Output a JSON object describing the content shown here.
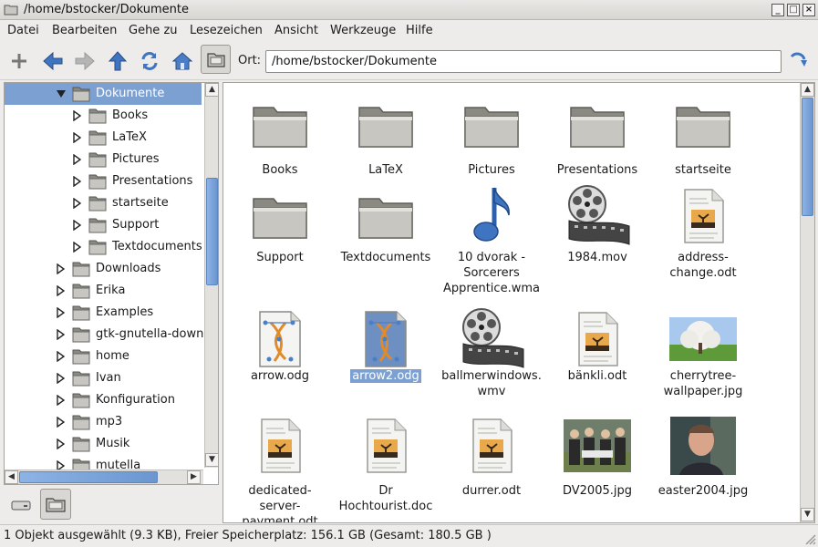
{
  "window": {
    "title": "/home/bstocker/Dokumente"
  },
  "menu": [
    "Datei",
    "Bearbeiten",
    "Gehe zu",
    "Lesezeichen",
    "Ansicht",
    "Werkzeuge",
    "Hilfe"
  ],
  "toolbar": {
    "location_label": "Ort:",
    "location_value": "/home/bstocker/Dokumente",
    "buttons": [
      "new-tab-icon",
      "back-icon",
      "forward-icon",
      "up-icon",
      "reload-icon",
      "home-icon",
      "folder-view-icon",
      "go-icon"
    ]
  },
  "tree": [
    {
      "label": "Dokumente",
      "level": 0,
      "expanded": true,
      "selected": true
    },
    {
      "label": "Books",
      "level": 1
    },
    {
      "label": "LaTeX",
      "level": 1
    },
    {
      "label": "Pictures",
      "level": 1
    },
    {
      "label": "Presentations",
      "level": 1
    },
    {
      "label": "startseite",
      "level": 1
    },
    {
      "label": "Support",
      "level": 1
    },
    {
      "label": "Textdocuments",
      "level": 1
    },
    {
      "label": "Downloads",
      "level": 0
    },
    {
      "label": "Erika",
      "level": 0
    },
    {
      "label": "Examples",
      "level": 0
    },
    {
      "label": "gtk-gnutella-down",
      "level": 0
    },
    {
      "label": "home",
      "level": 0
    },
    {
      "label": "Ivan",
      "level": 0
    },
    {
      "label": "Konfiguration",
      "level": 0
    },
    {
      "label": "mp3",
      "level": 0
    },
    {
      "label": "Musik",
      "level": 0
    },
    {
      "label": "mutella",
      "level": 0
    }
  ],
  "items": [
    {
      "name": "Books",
      "type": "folder"
    },
    {
      "name": "LaTeX",
      "type": "folder"
    },
    {
      "name": "Pictures",
      "type": "folder"
    },
    {
      "name": "Presentations",
      "type": "folder"
    },
    {
      "name": "startseite",
      "type": "folder"
    },
    {
      "name": "Support",
      "type": "folder"
    },
    {
      "name": "Textdocuments",
      "type": "folder"
    },
    {
      "name": "10 dvorak -\nSorcerers\nApprentice.wma",
      "type": "audio"
    },
    {
      "name": "1984.mov",
      "type": "video"
    },
    {
      "name": "address-\nchange.odt",
      "type": "odt"
    },
    {
      "name": "arrow.odg",
      "type": "odg"
    },
    {
      "name": "arrow2.odg",
      "type": "odg",
      "selected": true
    },
    {
      "name": "ballmerwindows.\nwmv",
      "type": "video"
    },
    {
      "name": "bänkli.odt",
      "type": "odt"
    },
    {
      "name": "cherrytree-\nwallpaper.jpg",
      "type": "photo-tree"
    },
    {
      "name": "dedicated-\nserver-\npayment.odt",
      "type": "odt"
    },
    {
      "name": "Dr\nHochtourist.doc",
      "type": "odt"
    },
    {
      "name": "durrer.odt",
      "type": "odt"
    },
    {
      "name": "DV2005.jpg",
      "type": "photo-group"
    },
    {
      "name": "easter2004.jpg",
      "type": "photo-person"
    }
  ],
  "status": "1 Objekt ausgewählt (9.3 KB), Freier Speicherplatz: 156.1 GB (Gesamt: 180.5 GB )"
}
